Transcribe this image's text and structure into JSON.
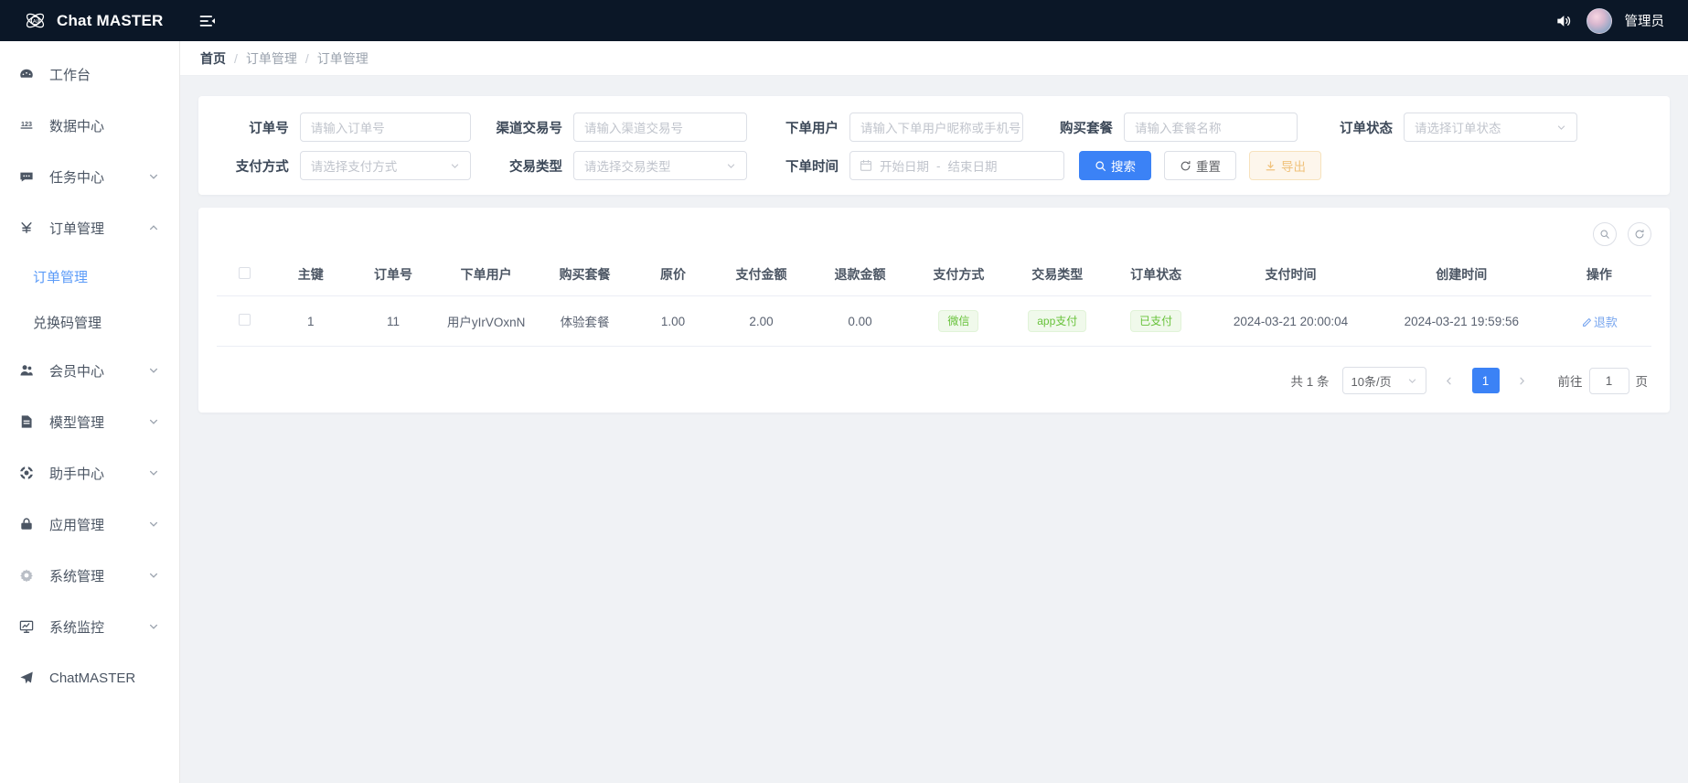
{
  "header": {
    "logo_text": "Chat MASTER",
    "username": "管理员",
    "icons": {
      "logo": "ai-atom-logo-icon",
      "collapse": "menu-collapse-icon",
      "sound": "sound-on-icon",
      "avatar": "user-avatar"
    }
  },
  "sidebar": {
    "items": [
      {
        "label": "工作台",
        "icon": "dashboard-icon",
        "expandable": false
      },
      {
        "label": "数据中心",
        "icon": "numbers-123-icon",
        "expandable": false
      },
      {
        "label": "任务中心",
        "icon": "chat-bubble-icon",
        "expandable": true,
        "expanded": false
      },
      {
        "label": "订单管理",
        "icon": "yen-currency-icon",
        "expandable": true,
        "expanded": true,
        "children": [
          {
            "label": "订单管理",
            "active": true
          },
          {
            "label": "兑换码管理",
            "active": false
          }
        ]
      },
      {
        "label": "会员中心",
        "icon": "user-group-icon",
        "expandable": true,
        "expanded": false
      },
      {
        "label": "模型管理",
        "icon": "document-icon",
        "expandable": true,
        "expanded": false
      },
      {
        "label": "助手中心",
        "icon": "compass-icon",
        "expandable": true,
        "expanded": false
      },
      {
        "label": "应用管理",
        "icon": "lock-icon",
        "expandable": true,
        "expanded": false
      },
      {
        "label": "系统管理",
        "icon": "gear-icon",
        "expandable": true,
        "expanded": false
      },
      {
        "label": "系统监控",
        "icon": "monitor-chart-icon",
        "expandable": true,
        "expanded": false
      },
      {
        "label": "ChatMASTER",
        "icon": "send-plane-icon",
        "expandable": false
      }
    ]
  },
  "breadcrumb": {
    "home": "首页",
    "level1": "订单管理",
    "level2": "订单管理",
    "separator": "/"
  },
  "search_form": {
    "row1": [
      {
        "label": "订单号",
        "placeholder": "请输入订单号",
        "type": "input",
        "value": ""
      },
      {
        "label": "渠道交易号",
        "placeholder": "请输入渠道交易号",
        "type": "input",
        "value": ""
      },
      {
        "label": "下单用户",
        "placeholder": "请输入下单用户昵称或手机号",
        "type": "input",
        "value": ""
      },
      {
        "label": "购买套餐",
        "placeholder": "请输入套餐名称",
        "type": "input",
        "value": ""
      },
      {
        "label": "订单状态",
        "placeholder": "请选择订单状态",
        "type": "select",
        "value": ""
      }
    ],
    "row2": [
      {
        "label": "支付方式",
        "placeholder": "请选择支付方式",
        "type": "select",
        "value": ""
      },
      {
        "label": "交易类型",
        "placeholder": "请选择交易类型",
        "type": "select",
        "value": ""
      }
    ],
    "date_range": {
      "label": "下单时间",
      "start_placeholder": "开始日期",
      "end_placeholder": "结束日期",
      "separator": "-",
      "icon": "calendar-icon"
    },
    "buttons": {
      "search": {
        "label": "搜索",
        "icon": "search-icon",
        "color": "#3b82f6"
      },
      "reset": {
        "label": "重置",
        "icon": "refresh-icon"
      },
      "export": {
        "label": "导出",
        "icon": "download-icon",
        "color": "#f0c27c"
      }
    }
  },
  "table_tools": {
    "search_icon": "search-circle-icon",
    "refresh_icon": "refresh-circle-icon"
  },
  "table": {
    "columns": [
      "",
      "主键",
      "订单号",
      "下单用户",
      "购买套餐",
      "原价",
      "支付金额",
      "退款金额",
      "支付方式",
      "交易类型",
      "订单状态",
      "支付时间",
      "创建时间",
      "操作"
    ],
    "rows": [
      {
        "id": "1",
        "order_no": "11",
        "user": "用户yIrVOxnN",
        "package": "体验套餐",
        "original_price": "1.00",
        "paid_amount": "2.00",
        "refund_amount": "0.00",
        "pay_method": "微信",
        "trade_type": "app支付",
        "order_status": "已支付",
        "pay_time": "2024-03-21 20:00:04",
        "create_time": "2024-03-21 19:59:56",
        "action": "退款",
        "action_icon": "edit-icon"
      }
    ]
  },
  "pagination": {
    "total_text": "共 1 条",
    "page_size": "10条/页",
    "prev_icon": "chevron-left-icon",
    "next_icon": "chevron-right-icon",
    "current_page": "1",
    "jump_prefix": "前往",
    "jump_value": "1",
    "jump_suffix": "页"
  },
  "colors": {
    "header_bg": "#0b1727",
    "primary": "#3b82f6",
    "active_menu": "#5b9bf8",
    "tag_green": "#67c23a",
    "tag_green_bg": "#f0f9eb",
    "warning": "#f0c27c",
    "page_bg": "#f0f2f5"
  }
}
